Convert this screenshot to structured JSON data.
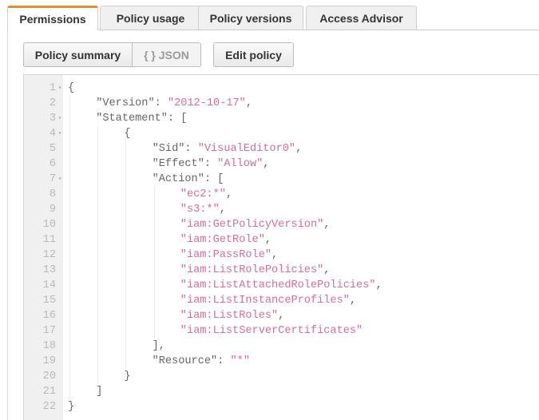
{
  "tabs": [
    {
      "label": "Permissions",
      "active": true
    },
    {
      "label": "Policy usage",
      "active": false
    },
    {
      "label": "Policy versions",
      "active": false
    },
    {
      "label": "Access Advisor",
      "active": false
    }
  ],
  "toolbar": {
    "policy_summary_label": "Policy summary",
    "json_label": "{ } JSON",
    "edit_policy_label": "Edit policy"
  },
  "colors": {
    "active_tab_accent": "#dd8e34",
    "string_value": "#d0709a",
    "gutter_bg": "#f0f0f0"
  },
  "editor": {
    "lines": [
      {
        "n": "1",
        "fold": true,
        "indent": 0,
        "key": "",
        "value": "",
        "text": "{"
      },
      {
        "n": "2",
        "fold": false,
        "indent": 1,
        "key": "\"Version\": ",
        "value": "\"2012-10-17\"",
        "text": ","
      },
      {
        "n": "3",
        "fold": true,
        "indent": 1,
        "key": "\"Statement\": ",
        "value": "",
        "text": "["
      },
      {
        "n": "4",
        "fold": true,
        "indent": 2,
        "key": "",
        "value": "",
        "text": "{"
      },
      {
        "n": "5",
        "fold": false,
        "indent": 3,
        "key": "\"Sid\": ",
        "value": "\"VisualEditor0\"",
        "text": ","
      },
      {
        "n": "6",
        "fold": false,
        "indent": 3,
        "key": "\"Effect\": ",
        "value": "\"Allow\"",
        "text": ","
      },
      {
        "n": "7",
        "fold": true,
        "indent": 3,
        "key": "\"Action\": ",
        "value": "",
        "text": "["
      },
      {
        "n": "8",
        "fold": false,
        "indent": 4,
        "key": "",
        "value": "\"ec2:*\"",
        "text": ","
      },
      {
        "n": "9",
        "fold": false,
        "indent": 4,
        "key": "",
        "value": "\"s3:*\"",
        "text": ","
      },
      {
        "n": "10",
        "fold": false,
        "indent": 4,
        "key": "",
        "value": "\"iam:GetPolicyVersion\"",
        "text": ","
      },
      {
        "n": "11",
        "fold": false,
        "indent": 4,
        "key": "",
        "value": "\"iam:GetRole\"",
        "text": ","
      },
      {
        "n": "12",
        "fold": false,
        "indent": 4,
        "key": "",
        "value": "\"iam:PassRole\"",
        "text": ","
      },
      {
        "n": "13",
        "fold": false,
        "indent": 4,
        "key": "",
        "value": "\"iam:ListRolePolicies\"",
        "text": ","
      },
      {
        "n": "14",
        "fold": false,
        "indent": 4,
        "key": "",
        "value": "\"iam:ListAttachedRolePolicies\"",
        "text": ","
      },
      {
        "n": "15",
        "fold": false,
        "indent": 4,
        "key": "",
        "value": "\"iam:ListInstanceProfiles\"",
        "text": ","
      },
      {
        "n": "16",
        "fold": false,
        "indent": 4,
        "key": "",
        "value": "\"iam:ListRoles\"",
        "text": ","
      },
      {
        "n": "17",
        "fold": false,
        "indent": 4,
        "key": "",
        "value": "\"iam:ListServerCertificates\"",
        "text": ""
      },
      {
        "n": "18",
        "fold": false,
        "indent": 3,
        "key": "",
        "value": "",
        "text": "],"
      },
      {
        "n": "19",
        "fold": false,
        "indent": 3,
        "key": "\"Resource\": ",
        "value": "\"*\"",
        "text": ""
      },
      {
        "n": "20",
        "fold": false,
        "indent": 2,
        "key": "",
        "value": "",
        "text": "}"
      },
      {
        "n": "21",
        "fold": false,
        "indent": 1,
        "key": "",
        "value": "",
        "text": "]"
      },
      {
        "n": "22",
        "fold": false,
        "indent": 0,
        "key": "",
        "value": "",
        "text": "}"
      }
    ]
  }
}
